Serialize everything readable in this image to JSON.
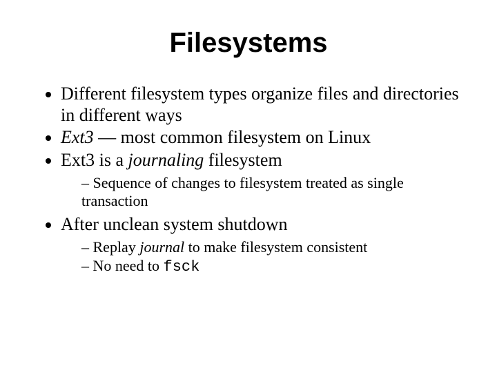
{
  "title": "Filesystems",
  "b1_a": "Different filesystem types organize files and directories in different ways",
  "b2_em": "Ext3",
  "b2_rest": " — most common filesystem on Linux",
  "b3_a": "Ext3 is a ",
  "b3_em": "journaling",
  "b3_b": " filesystem",
  "s3_1": "Sequence of changes to filesystem treated as single transaction",
  "b4": "After unclean system shutdown",
  "s4_1a": "Replay ",
  "s4_1em": "journal",
  "s4_1b": " to make filesystem consistent",
  "s4_2a": "No need to ",
  "s4_2code": "fsck"
}
